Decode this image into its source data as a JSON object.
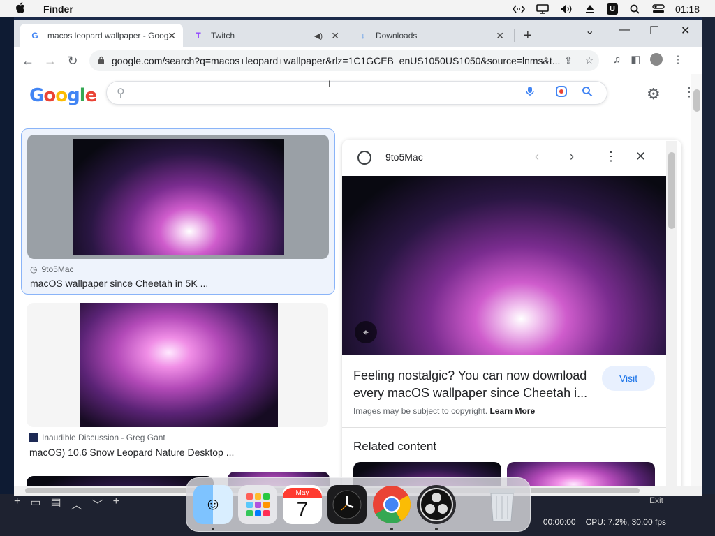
{
  "menubar": {
    "app_name": "Finder",
    "clock": "01:18",
    "icons": [
      "apple-icon",
      "code-icon",
      "display-icon",
      "volume-icon",
      "eject-icon",
      "u-icon",
      "search-icon",
      "control-center-icon"
    ],
    "u_label": "U"
  },
  "tabs": [
    {
      "label": "macos leopard wallpaper - Goog",
      "favicon": "G",
      "active": true
    },
    {
      "label": "Twitch",
      "favicon": "T",
      "active": false
    },
    {
      "label": "Downloads",
      "favicon": "↓",
      "active": false
    }
  ],
  "toolbar": {
    "url": "google.com/search?q=macos+leopard+wallpaper&rlz=1C1GCEB_enUS1050US1050&source=lnms&t..."
  },
  "search": {
    "logo_letters": [
      "G",
      "o",
      "o",
      "g",
      "l",
      "e"
    ],
    "query": ""
  },
  "results": [
    {
      "source": "9to5Mac",
      "title": "macOS wallpaper since Cheetah in 5K ..."
    },
    {
      "source": "Inaudible Discussion - Greg Gant",
      "title": "macOS) 10.6 Snow Leopard Nature Desktop ..."
    }
  ],
  "panel": {
    "source": "9to5Mac",
    "title": "Feeling nostalgic? You can now download every macOS wallpaper since Cheetah i...",
    "visit_label": "Visit",
    "copyright_text": "Images may be subject to copyright.",
    "learn_more": "Learn More",
    "related_heading": "Related content"
  },
  "obs": {
    "timecode": "00:00:00",
    "cpu": "CPU: 7.2%, 30.00 fps",
    "exit_label": "Exit"
  },
  "dock": {
    "calendar_month": "May",
    "calendar_day": "7"
  },
  "colors": {
    "google_blue": "#4285f4",
    "google_red": "#ea4335",
    "google_yellow": "#fbbc05",
    "google_green": "#34a853",
    "link_blue": "#1a73e8"
  }
}
